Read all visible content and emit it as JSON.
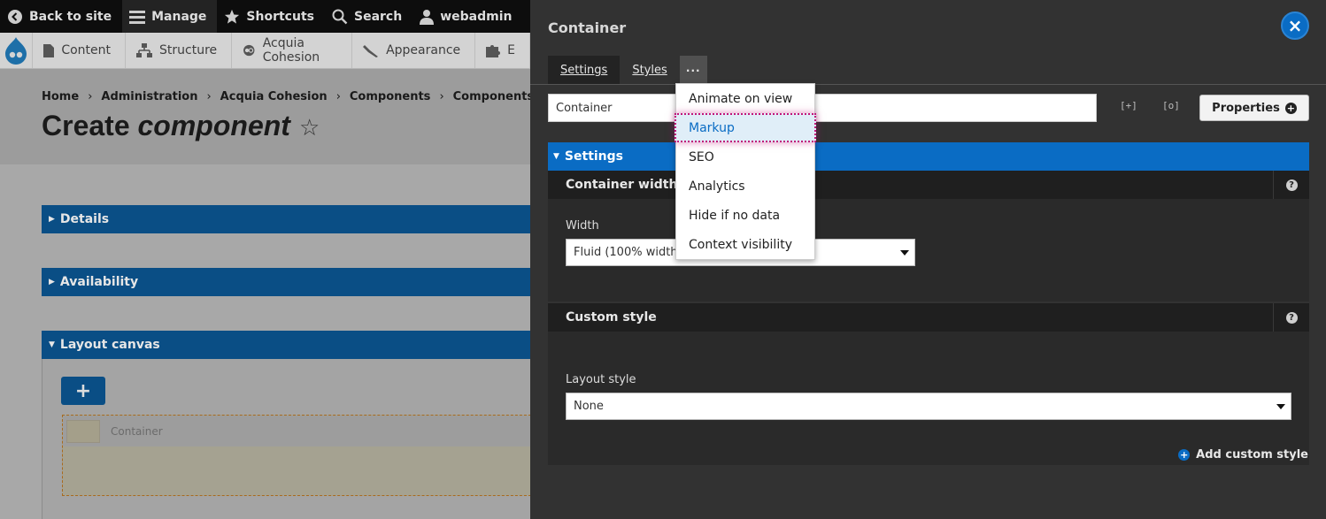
{
  "admin_toolbar": {
    "back_to_site": "Back to site",
    "manage": "Manage",
    "shortcuts": "Shortcuts",
    "search": "Search",
    "user": "webadmin"
  },
  "admin_menu": {
    "items": [
      "Content",
      "Structure",
      "Acquia Cohesion",
      "Appearance",
      "E"
    ]
  },
  "breadcrumb": [
    "Home",
    "Administration",
    "Acquia Cohesion",
    "Components",
    "Components"
  ],
  "page": {
    "title_prefix": "Create ",
    "title_emphasis": "component",
    "star": "☆"
  },
  "sections": {
    "details": "Details",
    "availability": "Availability",
    "layout_canvas": "Layout canvas"
  },
  "canvas": {
    "add_label": "+",
    "container_label": "Container"
  },
  "sidebar": {
    "title": "Container",
    "close": "×",
    "tabs": [
      "Settings",
      "Styles"
    ],
    "more_tab": "···",
    "title_field_value": "Container",
    "expand_icon": "[+]",
    "collapse_icon": "[o]",
    "properties_label": "Properties",
    "settings_header": "Settings",
    "container_width": {
      "title": "Container width",
      "width_label": "Width",
      "width_value": "Fluid (100% width c"
    },
    "custom_style": {
      "title": "Custom style",
      "layout_style_label": "Layout style",
      "layout_style_value": "None",
      "add_label": "Add custom style"
    }
  },
  "dropdown": {
    "items": [
      "Animate on view",
      "Markup",
      "SEO",
      "Analytics",
      "Hide if no data",
      "Context visibility"
    ],
    "highlighted": "Markup"
  },
  "colors": {
    "accent": "#0a6cc4",
    "panel_bg": "#323232",
    "highlight_outline": "#c2147a"
  }
}
